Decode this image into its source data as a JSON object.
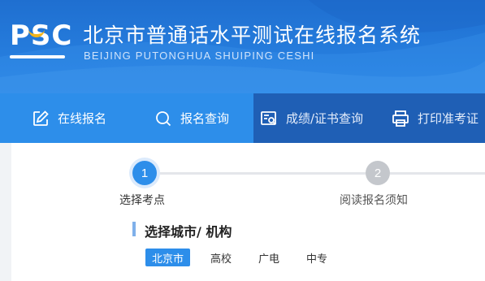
{
  "header": {
    "logo_text": "PSC",
    "title": "北京市普通话水平测试在线报名系统",
    "subtitle": "BEIJING PUTONGHUA SHUIPING CESHI"
  },
  "nav": {
    "items": [
      {
        "label": "在线报名",
        "icon": "edit-icon",
        "active": true
      },
      {
        "label": "报名查询",
        "icon": "search-icon",
        "active": true
      },
      {
        "label": "成绩/证书查询",
        "icon": "certificate-search-icon",
        "active": false
      },
      {
        "label": "打印准考证",
        "icon": "printer-icon",
        "active": false
      }
    ]
  },
  "steps": [
    {
      "number": "1",
      "label": "选择考点",
      "state": "active"
    },
    {
      "number": "2",
      "label": "阅读报名须知",
      "state": "inactive"
    }
  ],
  "section": {
    "title": "选择城市/ 机构"
  },
  "city_tabs": [
    {
      "label": "北京市",
      "selected": true
    },
    {
      "label": "高校",
      "selected": false
    },
    {
      "label": "广电",
      "selected": false
    },
    {
      "label": "中专",
      "selected": false
    }
  ],
  "colors": {
    "header_blue": "#2a86e6",
    "nav_dark": "#1f5fb5",
    "nav_light": "#2d8eea",
    "accent": "#2d8eea",
    "logo_accent": "#f2b41b",
    "step_inactive": "#c4c7cc"
  }
}
